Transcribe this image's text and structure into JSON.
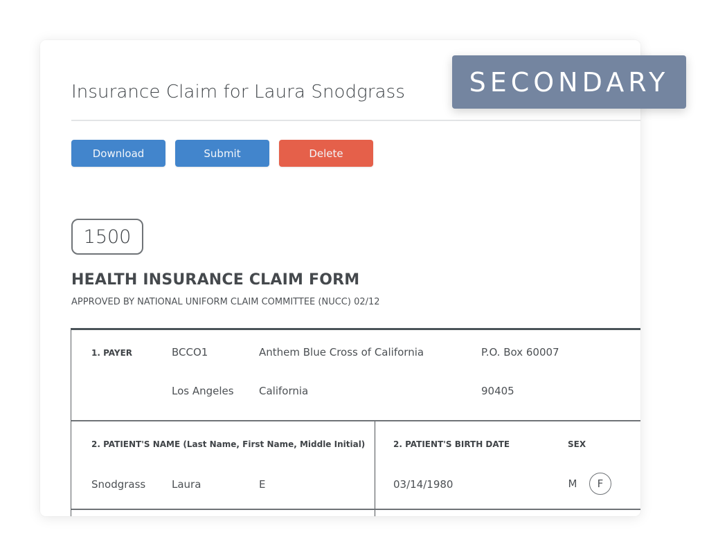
{
  "header": {
    "title": "Insurance Claim for Laura Snodgrass",
    "badge": "SECONDARY"
  },
  "toolbar": {
    "download_label": "Download",
    "submit_label": "Submit",
    "delete_label": "Delete"
  },
  "colors": {
    "primary_button": "#4285cc",
    "danger_button": "#e5604a",
    "badge_background": "#7485a0"
  },
  "form": {
    "number": "1500",
    "heading": "HEALTH INSURANCE CLAIM FORM",
    "subheading": "APPROVED BY NATIONAL UNIFORM CLAIM COMMITTEE (NUCC) 02/12",
    "payer": {
      "label": "1. PAYER",
      "code": "BCCO1",
      "name": "Anthem Blue Cross of California",
      "address": "P.O. Box 60007",
      "city": "Los Angeles",
      "state": "California",
      "zip": "90405"
    },
    "patient_name": {
      "label": "2. PATIENT'S NAME (Last Name, First Name, Middle Initial)",
      "last": "Snodgrass",
      "first": "Laura",
      "middle": "E"
    },
    "patient_birth_date": {
      "label": "2. PATIENT'S BIRTH DATE",
      "value": "03/14/1980"
    },
    "sex": {
      "label": "SEX",
      "options": [
        "M",
        "F"
      ],
      "selected": "F"
    }
  }
}
